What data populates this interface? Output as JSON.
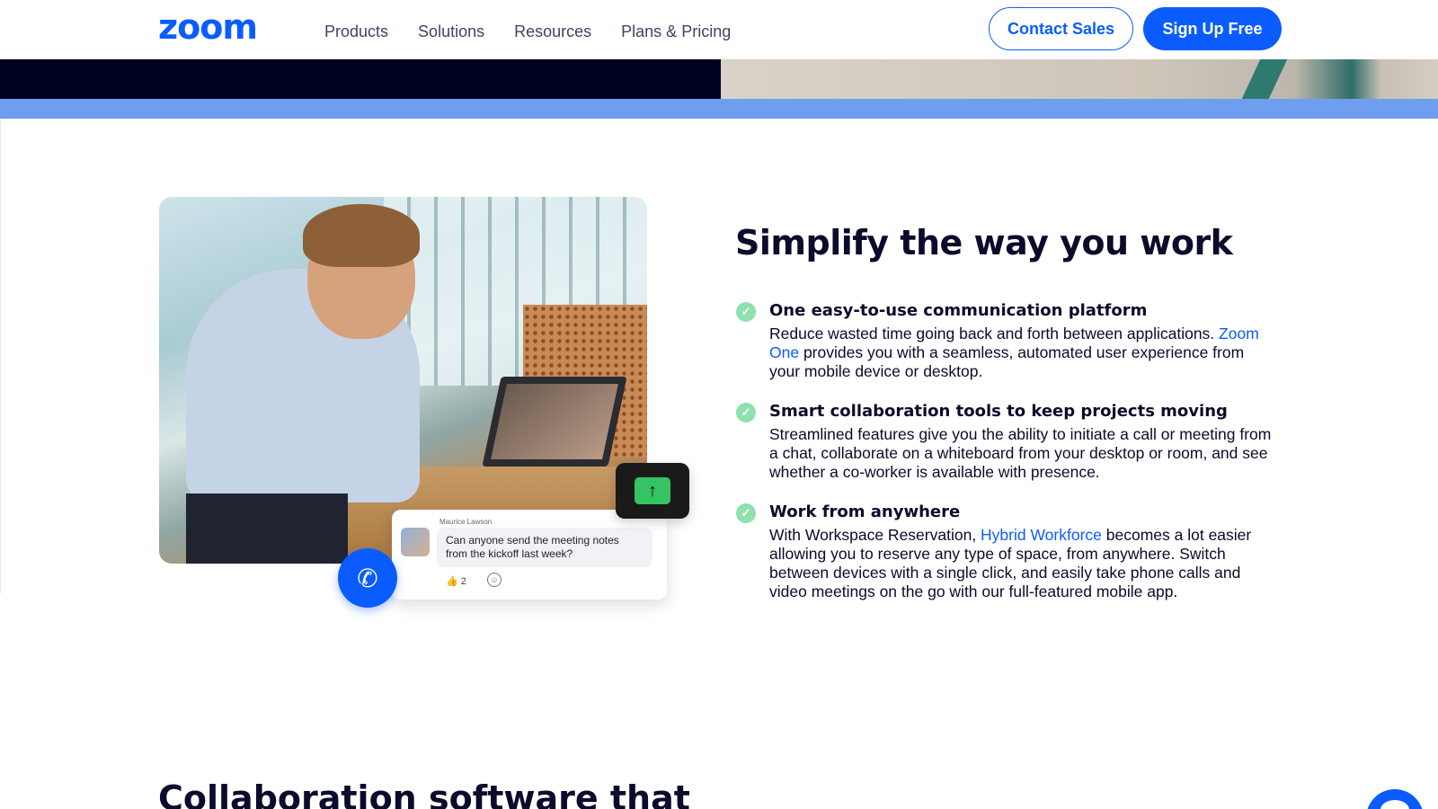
{
  "header": {
    "logo": "zoom",
    "nav": [
      "Products",
      "Solutions",
      "Resources",
      "Plans & Pricing"
    ],
    "contact_sales": "Contact Sales",
    "sign_up": "Sign Up Free"
  },
  "image": {
    "chat_name": "Maurice Lawson",
    "chat_message": "Can anyone send the meeting notes from the kickoff last week?",
    "reaction": "👍 2"
  },
  "section": {
    "headline": "Simplify the way you work",
    "features": [
      {
        "title": "One easy-to-use communication platform",
        "body_pre": "Reduce wasted time going back and forth between applications. ",
        "link": "Zoom One",
        "body_post": " provides you with a seamless, automated user experience from your mobile device or desktop."
      },
      {
        "title": "Smart collaboration tools to keep projects moving",
        "body_pre": "Streamlined features give you the ability to initiate a call or meeting from a chat, collaborate on a whiteboard from your desktop or room, and see whether a co-worker is available with presence.",
        "link": "",
        "body_post": ""
      },
      {
        "title": "Work from anywhere",
        "body_pre": "With Workspace Reservation, ",
        "link": "Hybrid Workforce",
        "body_post": " becomes a lot easier allowing you to reserve any type of space, from anywhere. Switch between devices with a single click, and easily take phone calls and video meetings on the go with our full-featured mobile app."
      }
    ]
  },
  "next_section": {
    "heading": "Collaboration software that"
  },
  "colors": {
    "brand": "#0b5cff",
    "accent_bar": "#6f9ef1",
    "check": "#8fe0ad",
    "hero_dark": "#00031f"
  },
  "icons": {
    "check": "check-circle-icon",
    "phone": "phone-icon",
    "upload": "upload-arrow-icon",
    "chat": "chat-bubble-icon",
    "emoji": "add-reaction-icon"
  }
}
